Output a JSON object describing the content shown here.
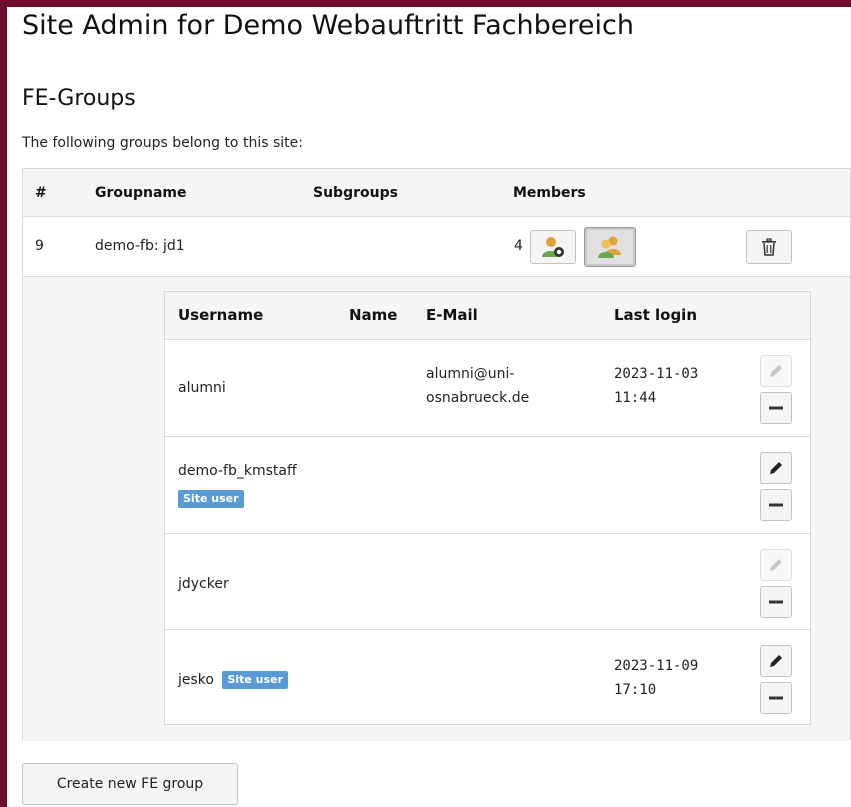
{
  "page": {
    "title": "Site Admin for Demo Webauftritt Fachbereich",
    "subtitle": "FE-Groups",
    "intro": "The following groups belong to this site:"
  },
  "groups_table": {
    "headers": {
      "id": "#",
      "groupname": "Groupname",
      "subgroups": "Subgroups",
      "members": "Members"
    },
    "row": {
      "id": "9",
      "groupname": "demo-fb: jd1",
      "subgroups": "",
      "member_count": "4"
    }
  },
  "members_table": {
    "headers": {
      "username": "Username",
      "name": "Name",
      "email": "E-Mail",
      "last_login": "Last login"
    },
    "rows": [
      {
        "username": "alumni",
        "badge": "",
        "name": "",
        "email_line1": "alumni@uni-",
        "email_line2": "osnabrueck.de",
        "login_date": "2023-11-03",
        "login_time": "11:44",
        "edit_enabled": false
      },
      {
        "username": "demo-fb_kmstaff",
        "badge": "Site user",
        "name": "",
        "email_line1": "",
        "email_line2": "",
        "login_date": "",
        "login_time": "",
        "edit_enabled": true
      },
      {
        "username": "jdycker",
        "badge": "",
        "name": "",
        "email_line1": "",
        "email_line2": "",
        "login_date": "",
        "login_time": "",
        "edit_enabled": false
      },
      {
        "username": "jesko",
        "badge": "Site user",
        "name": "",
        "email_line1": "",
        "email_line2": "",
        "login_date": "2023-11-09",
        "login_time": "17:10",
        "edit_enabled": true
      }
    ]
  },
  "create_button": "Create new FE group",
  "colors": {
    "frame": "#6d0f2c",
    "badge": "#5b9bd5"
  },
  "icons": {
    "add_member": "user-add-icon",
    "show_members": "users-icon",
    "delete": "trash-icon",
    "edit": "pencil-icon",
    "remove": "minus-icon"
  }
}
